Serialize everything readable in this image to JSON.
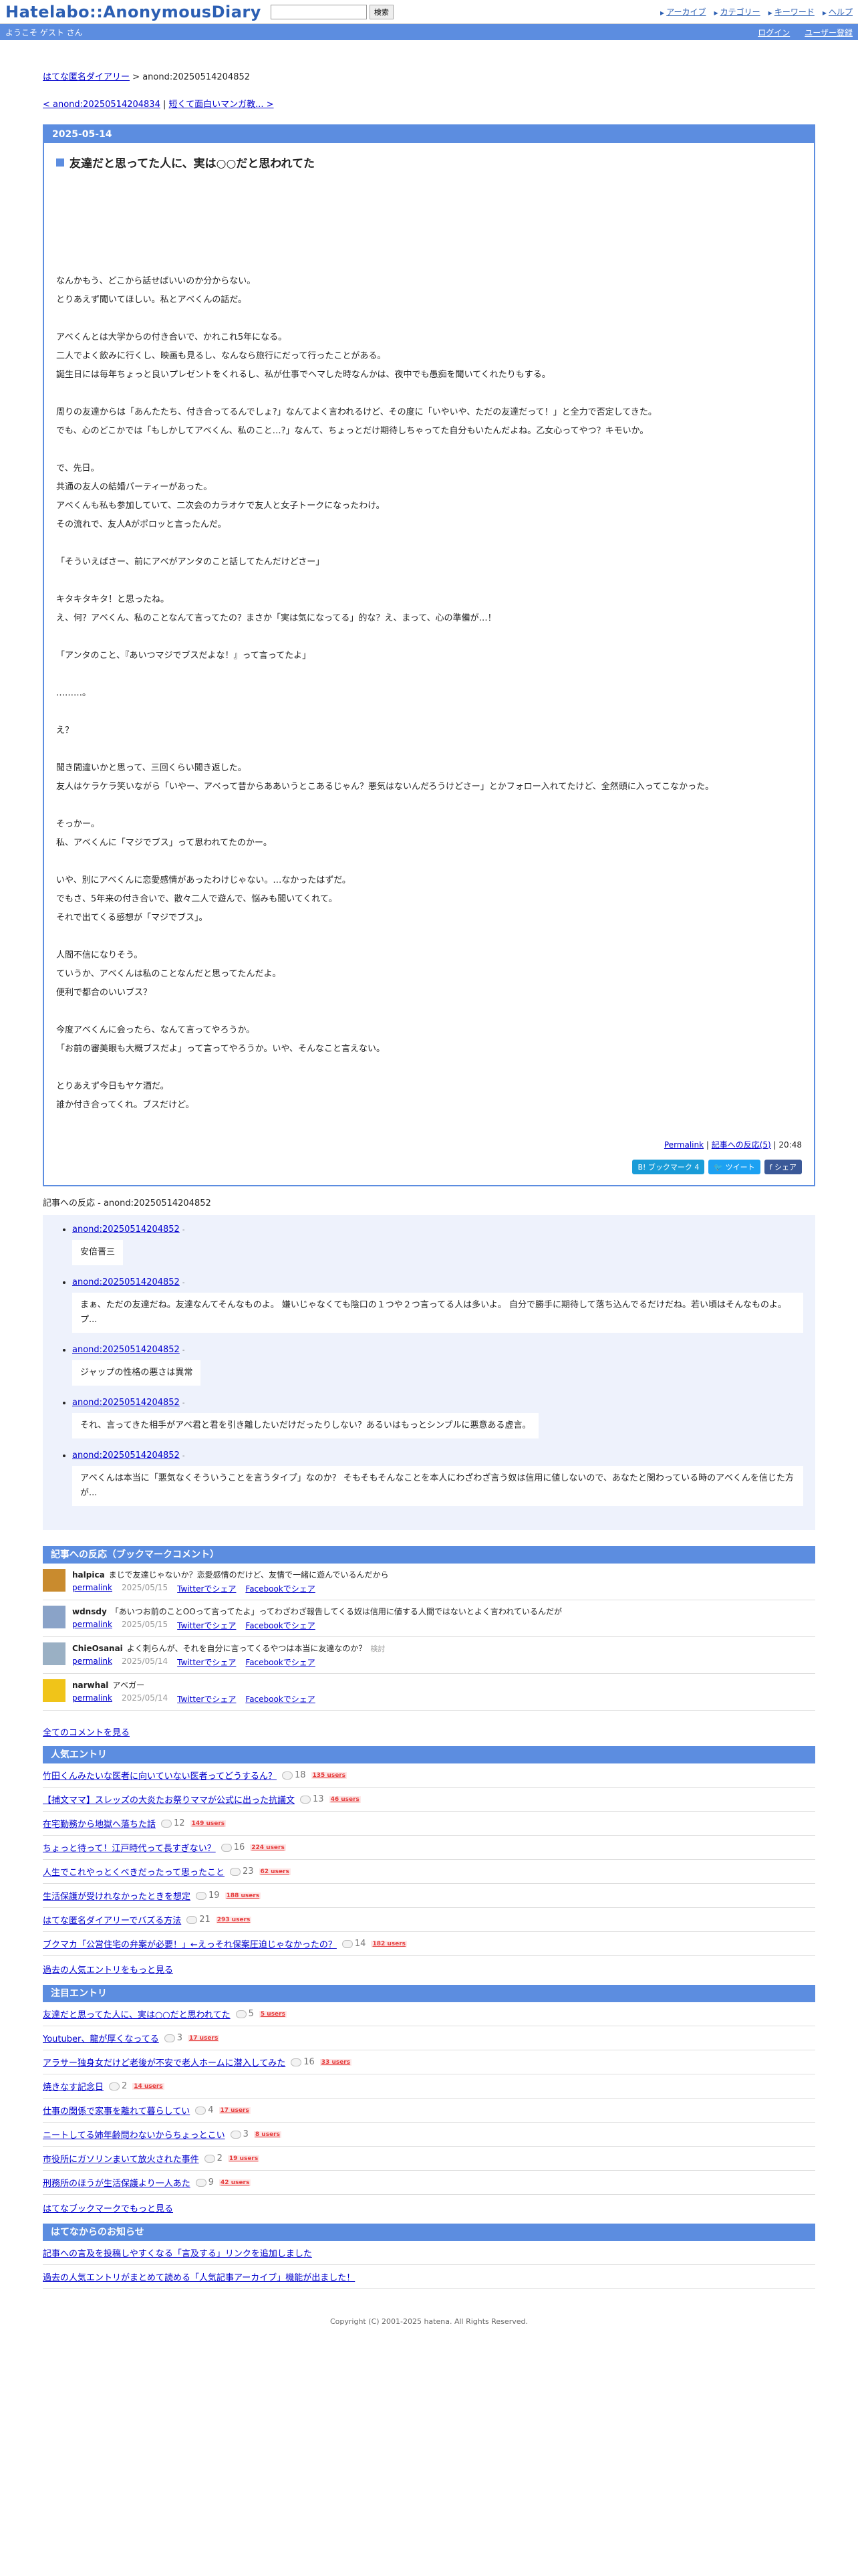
{
  "header": {
    "logo": "Hatelabo::AnonymousDiary",
    "search_placeholder": "",
    "search_button": "検索",
    "links": [
      "アーカイブ",
      "カテゴリー",
      "キーワード",
      "ヘルプ"
    ]
  },
  "bluebar": {
    "welcome": "ようこそ ゲスト さん",
    "login": "ログイン",
    "register": "ユーザー登録"
  },
  "breadcrumb": {
    "home": "はてな匿名ダイアリー",
    "sep": " > ",
    "current": "anond:20250514204852"
  },
  "nav": {
    "prev": "< anond:20250514204834",
    "sep": " | ",
    "next": "短くて面白いマンガ教... >"
  },
  "entry": {
    "date": "2025-05-14",
    "title": "友達だと思ってた人に、実は○○だと思われてた",
    "paragraphs": [
      [
        "なんかもう、どこから話せばいいのか分からない。",
        "とりあえず聞いてほしい。私とアベくんの話だ。"
      ],
      [
        "アベくんとは大学からの付き合いで、かれこれ5年になる。",
        "二人でよく飲みに行くし、映画も見るし、なんなら旅行にだって行ったことがある。",
        "誕生日には毎年ちょっと良いプレゼントをくれるし、私が仕事でヘマした時なんかは、夜中でも愚痴を聞いてくれたりもする。"
      ],
      [
        "周りの友達からは「あんたたち、付き合ってるんでしょ?」なんてよく言われるけど、その度に「いやいや、ただの友達だって！」と全力で否定してきた。",
        "でも、心のどこかでは「もしかしてアベくん、私のこと…?」なんて、ちょっとだけ期待しちゃってた自分もいたんだよね。乙女心ってやつ？キモいか。"
      ],
      [
        "で、先日。",
        "共通の友人の結婚パーティーがあった。",
        "アベくんも私も参加していて、二次会のカラオケで友人と女子トークになったわけ。",
        "その流れで、友人Aがポロッと言ったんだ。"
      ],
      [
        "「そういえばさー、前にアベがアンタのこと話してたんだけどさー」"
      ],
      [
        "キタキタキタ！と思ったね。",
        "え、何？アベくん、私のことなんて言ってたの？まさか「実は気になってる」的な？え、まって、心の準備が…！"
      ],
      [
        "「アンタのこと、『あいつマジでブスだよな！』って言ってたよ」"
      ],
      [
        "………。"
      ],
      [
        "え？"
      ],
      [
        "聞き間違いかと思って、三回くらい聞き返した。",
        "友人はケラケラ笑いながら「いやー、アベって昔からああいうとこあるじゃん？悪気はないんだろうけどさー」とかフォロー入れてたけど、全然頭に入ってこなかった。"
      ],
      [
        "そっかー。",
        "私、アベくんに「マジでブス」って思われてたのかー。"
      ],
      [
        "いや、別にアベくんに恋愛感情があったわけじゃない。…なかったはずだ。",
        "でもさ、5年来の付き合いで、散々二人で遊んで、悩みも聞いてくれて。",
        "それで出てくる感想が「マジでブス」。"
      ],
      [
        "人間不信になりそう。",
        "ていうか、アベくんは私のことなんだと思ってたんだよ。",
        "便利で都合のいいブス？"
      ],
      [
        "今度アベくんに会ったら、なんて言ってやろうか。",
        "「お前の審美眼も大概ブスだよ」って言ってやろうか。いや、そんなこと言えない。"
      ],
      [
        "とりあえず今日もヤケ酒だ。",
        "誰か付き合ってくれ。ブスだけど。"
      ]
    ],
    "permalink": "Permalink",
    "reaction_link": "記事への反応(5)",
    "time": "20:48",
    "share_hb": "B! ブックマーク 4",
    "share_tw": "ツイート",
    "share_fb": "シェア"
  },
  "reactions": {
    "title": "記事への反応 - anond:20250514204852",
    "items": [
      {
        "link": "anond:20250514204852",
        "arrow": "-",
        "body": "安倍晋三"
      },
      {
        "link": "anond:20250514204852",
        "arrow": "-",
        "body": "まぁ、ただの友達だね。友達なんてそんなものよ。 嫌いじゃなくても陰口の１つや２つ言ってる人は多いよ。 自分で勝手に期待して落ち込んでるだけだね。若い頃はそんなものよ。 プ..."
      },
      {
        "link": "anond:20250514204852",
        "arrow": "-",
        "body": "ジャップの性格の悪さは異常"
      },
      {
        "link": "anond:20250514204852",
        "arrow": "-",
        "body": "それ、言ってきた相手がアベ君と君を引き離したいだけだったりしない？あるいはもっとシンプルに悪意ある虚言。"
      },
      {
        "link": "anond:20250514204852",
        "arrow": "-",
        "body": "アベくんは本当に「悪気なくそういうことを言うタイプ」なのか？ そもそもそんなことを本人にわざわざ言う奴は信用に値しないので、あなたと関わっている時のアベくんを信じた方が..."
      }
    ]
  },
  "bookmarks": {
    "title": "記事への反応（ブックマークコメント）",
    "items": [
      {
        "user": "halpica",
        "comment": "まじで友達じゃないか？恋愛感情のだけど、友情で一緒に遊んでいるんだから",
        "date": "2025/05/15",
        "avatar_color": "#c98b2e"
      },
      {
        "user": "wdnsdy",
        "comment": "「あいつお前のことOOって言ってたよ」ってわざわざ報告してくる奴は信用に値する人間ではないとよく言われているんだが",
        "date": "2025/05/15",
        "avatar_color": "#8aa3c8"
      },
      {
        "user": "ChieOsanai",
        "comment": "よく刺らんが、それを自分に言ってくるやつは本当に友達なのか？",
        "extra": "検討",
        "date": "2025/05/14",
        "avatar_color": "#9ab0c4"
      },
      {
        "user": "narwhal",
        "comment": "アベガー",
        "date": "2025/05/14",
        "avatar_color": "#f0c419"
      }
    ],
    "permalink": "permalink",
    "twitter": "Twitterでシェア",
    "facebook": "Facebookでシェア",
    "all_comments": "全てのコメントを見る"
  },
  "popular": {
    "title": "人気エントリ",
    "items": [
      {
        "title": "竹田くんみたいな医者に向いていない医者ってどうするん？",
        "count": "18",
        "users": "135 users"
      },
      {
        "title": "【捕文ママ】スレッズの大炎たお祭りママが公式に出った抗議文",
        "count": "13",
        "users": "46 users"
      },
      {
        "title": "在宅勤務から地獄へ落ちた話",
        "count": "12",
        "users": "149 users"
      },
      {
        "title": "ちょっと待って！江戸時代って長すぎない？",
        "count": "16",
        "users": "224 users"
      },
      {
        "title": "人生でこれやっとくべきだったって思ったこと",
        "count": "23",
        "users": "62 users"
      },
      {
        "title": "生活保護が受けれなかったときを想定",
        "count": "19",
        "users": "188 users"
      },
      {
        "title": "はてな匿名ダイアリーでバズる方法",
        "count": "21",
        "users": "293 users"
      },
      {
        "title": "ブクマカ「公営住宅の弁案が必要！」←えっそれ保案圧迫じゃなかったの？",
        "count": "14",
        "users": "182 users"
      }
    ],
    "more": "過去の人気エントリをもっと見る"
  },
  "featured": {
    "title": "注目エントリ",
    "items": [
      {
        "title": "友達だと思ってた人に、実は○○だと思われてた",
        "count": "5",
        "users": "5 users"
      },
      {
        "title": "Youtuber、龍が厚くなってる",
        "count": "3",
        "users": "17 users"
      },
      {
        "title": "アラサー独身女だけど老後が不安で老人ホームに潜入してみた",
        "count": "16",
        "users": "33 users"
      },
      {
        "title": "焼きなす記念日",
        "count": "2",
        "users": "14 users"
      },
      {
        "title": "仕事の関係で家事を離れて暮らしてい",
        "count": "4",
        "users": "17 users"
      },
      {
        "title": "ニートしてる姉年齢問わないからちょっとこい",
        "count": "3",
        "users": "8 users"
      },
      {
        "title": "市役所にガソリンまいて放火された事件",
        "count": "2",
        "users": "19 users"
      },
      {
        "title": "刑務所のほうが生活保護より一人あた",
        "count": "9",
        "users": "42 users"
      }
    ],
    "more": "はてなブックマークでもっと見る"
  },
  "news": {
    "title": "はてなからのお知らせ",
    "items": [
      "記事への言及を投稿しやすくなる「言及する」リンクを追加しました",
      "過去の人気エントリがまとめて読める「人気記事アーカイブ」機能が出ました！"
    ]
  },
  "copyright": "Copyright (C) 2001-2025 hatena. All Rights Reserved."
}
